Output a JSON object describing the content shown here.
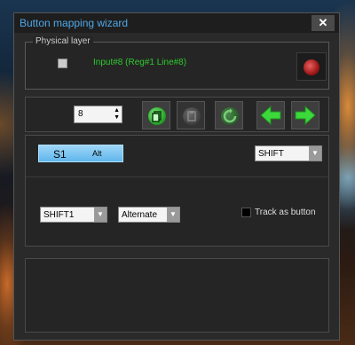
{
  "window": {
    "title": "Button mapping wizard",
    "close_label": "✕"
  },
  "physical_layer": {
    "group_title": "Physical layer",
    "input_info": "Input#8 (Reg#1  Line#8)",
    "checked": false
  },
  "toolbar": {
    "spin_value": "8",
    "buttons": [
      "copy-icon",
      "paste-icon",
      "refresh-icon",
      "arrow-left-icon",
      "arrow-right-icon"
    ]
  },
  "mapping": {
    "s1_label": "S1",
    "alt_label": "Alt",
    "modifier_dropdown": "SHIFT",
    "shift_select": "SHIFT1",
    "mode_select": "Alternate",
    "track_label": "Track as button"
  },
  "colors": {
    "accent": "#4fa8e8",
    "status_green": "#2ec82e",
    "button_blue": "#5fb6ec"
  }
}
